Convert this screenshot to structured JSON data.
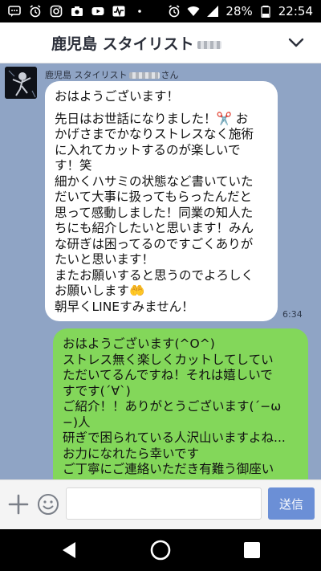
{
  "status_bar": {
    "battery": "28%",
    "time": "22:54",
    "icons_left": [
      "sms-icon",
      "alarm-icon",
      "instagram-icon",
      "camera-icon",
      "youtube-icon",
      "activity-icon",
      "more-dots-icon"
    ],
    "icons_right": [
      "alarm-icon",
      "wifi-icon",
      "signal-icon",
      "battery-icon"
    ]
  },
  "header": {
    "title": "鹿児島 スタイリスト"
  },
  "incoming": {
    "sender": "鹿児島 スタイリスト",
    "sender_suffix": "さん",
    "time": "6:34",
    "lines_p1": [
      "おはようございます！"
    ],
    "lines_p2": [
      "先日はお世話になりました！✂️ お",
      "かげさまでかなりストレスなく施術",
      "に入れてカットするのが楽しいで",
      "す！笑",
      "細かくハサミの状態など書いていた",
      "だいて大事に扱ってもらったんだと",
      "思って感動しました！同業の知人た",
      "ちにも紹介したいと思います！みん",
      "な研ぎは困ってるのですごくありが",
      "たいと思います！",
      "またお願いすると思うのでよろしく",
      "お願いします🤲",
      "朝早くLINEすみません！"
    ]
  },
  "outgoing": {
    "lines": [
      "おはようございます(^O^)",
      "ストレス無く楽しくカットしてしてい",
      "ただいてるんですね！それは嬉しいで",
      "すです(´∀`)",
      "ご紹介！！ありがとうございます(´−ω",
      "−)人",
      "研ぎで困られている人沢山いますよね...",
      "お力になれたら幸いです",
      "ご丁寧にご連絡いただき有難う御座い"
    ]
  },
  "input_bar": {
    "placeholder": "",
    "send_label": "送信"
  },
  "colors": {
    "chat_bg": "#8fa4c5",
    "incoming_bubble": "#ffffff",
    "outgoing_bubble": "#83d75a",
    "send_button": "#6b8fd6"
  }
}
